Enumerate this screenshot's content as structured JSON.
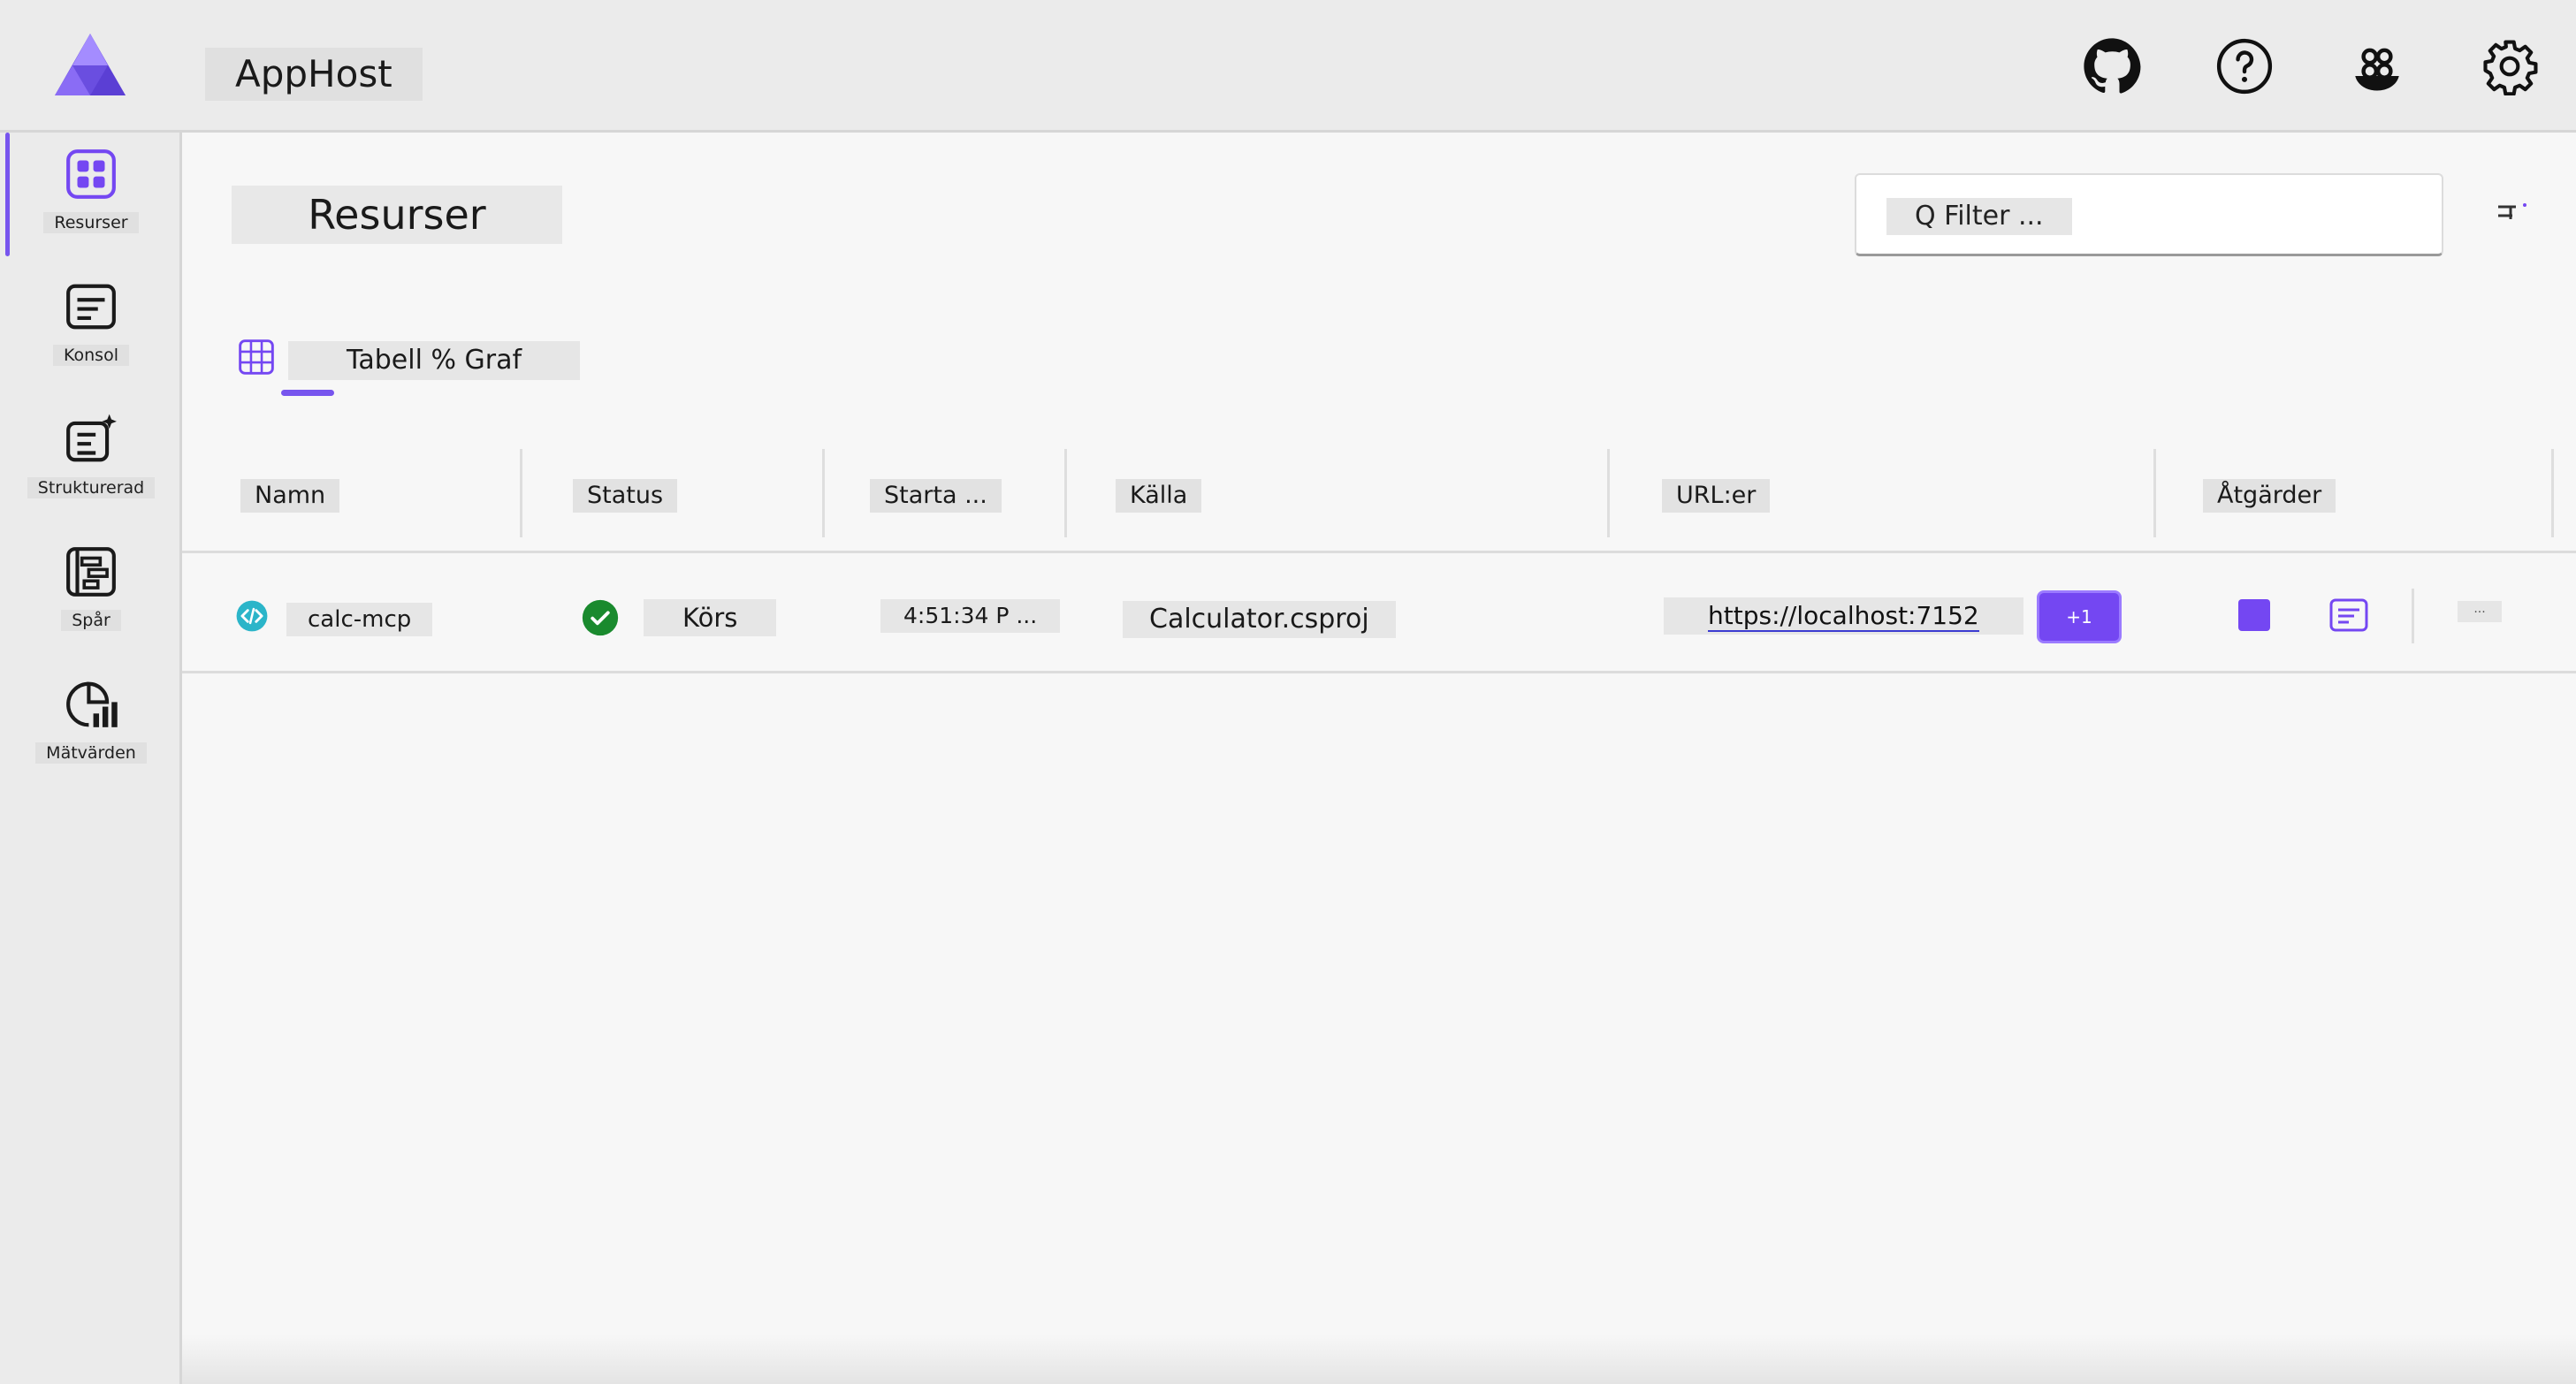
{
  "header": {
    "title": "AppHost",
    "icons": [
      "github-icon",
      "help-icon",
      "feedback-icon",
      "settings-icon"
    ]
  },
  "sidebar": {
    "items": [
      {
        "label": "Resurser",
        "icon": "resources-icon",
        "active": true
      },
      {
        "label": "Konsol",
        "icon": "console-icon"
      },
      {
        "label": "Strukturerad",
        "icon": "structured-icon"
      },
      {
        "label": "Spår",
        "icon": "traces-icon"
      },
      {
        "label": "Mätvärden",
        "icon": "metrics-icon"
      }
    ]
  },
  "main": {
    "title": "Resurser",
    "filter_placeholder": "Q Filter ...",
    "view_tabs": "Tabell % Graf"
  },
  "table": {
    "columns": [
      "Namn",
      "Status",
      "Starta ...",
      "Källa",
      "URL:er",
      "Åtgärder"
    ],
    "rows": [
      {
        "name": "calc-mcp",
        "status": "Körs",
        "start": "4:51:34 P ...",
        "source": "Calculator.csproj",
        "url": "https://localhost:7152",
        "more_urls": "+1",
        "more_actions": "..."
      }
    ]
  },
  "colors": {
    "accent": "#7447f2",
    "running": "#1a8a2e",
    "project_icon": "#2bb5c9"
  }
}
